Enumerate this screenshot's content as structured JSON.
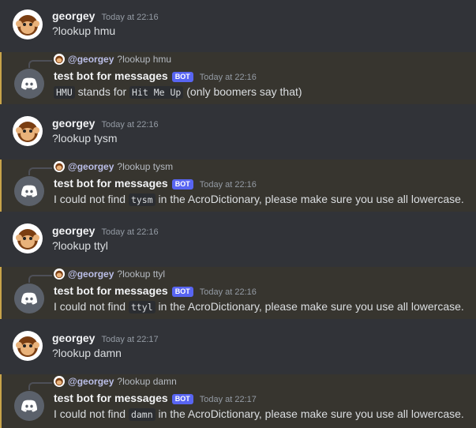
{
  "messages": [
    {
      "kind": "user",
      "username": "georgey",
      "timestamp": "Today at 22:16",
      "text": "?lookup hmu"
    },
    {
      "kind": "bot",
      "reply_user": "@georgey",
      "reply_text": "?lookup hmu",
      "username": "test bot for messages",
      "tag": "BOT",
      "timestamp": "Today at 22:16",
      "parts": [
        {
          "code": "HMU"
        },
        {
          "t": " stands for "
        },
        {
          "code": "Hit Me Up"
        },
        {
          "t": " (only boomers say that)"
        }
      ]
    },
    {
      "kind": "user",
      "username": "georgey",
      "timestamp": "Today at 22:16",
      "text": "?lookup tysm"
    },
    {
      "kind": "bot",
      "reply_user": "@georgey",
      "reply_text": "?lookup tysm",
      "username": "test bot for messages",
      "tag": "BOT",
      "timestamp": "Today at 22:16",
      "parts": [
        {
          "t": "I could not find "
        },
        {
          "code": "tysm"
        },
        {
          "t": " in the AcroDictionary, please make sure you use all lowercase."
        }
      ]
    },
    {
      "kind": "user",
      "username": "georgey",
      "timestamp": "Today at 22:16",
      "text": "?lookup ttyl"
    },
    {
      "kind": "bot",
      "reply_user": "@georgey",
      "reply_text": "?lookup ttyl",
      "username": "test bot for messages",
      "tag": "BOT",
      "timestamp": "Today at 22:16",
      "parts": [
        {
          "t": "I could not find "
        },
        {
          "code": "ttyl"
        },
        {
          "t": " in the AcroDictionary, please make sure you use all lowercase."
        }
      ]
    },
    {
      "kind": "user",
      "username": "georgey",
      "timestamp": "Today at 22:17",
      "text": "?lookup damn"
    },
    {
      "kind": "bot",
      "reply_user": "@georgey",
      "reply_text": "?lookup damn",
      "username": "test bot for messages",
      "tag": "BOT",
      "timestamp": "Today at 22:17",
      "parts": [
        {
          "t": "I could not find "
        },
        {
          "code": "damn"
        },
        {
          "t": " in the AcroDictionary, please make sure you use all lowercase."
        }
      ]
    }
  ],
  "icons": {
    "user_avatar": "monkey-avatar-icon",
    "bot_avatar": "discord-logo-icon"
  },
  "colors": {
    "background": "#313338",
    "highlight": "#37352f",
    "highlight_border": "#c7a34a",
    "bot_tag": "#5865f2"
  }
}
